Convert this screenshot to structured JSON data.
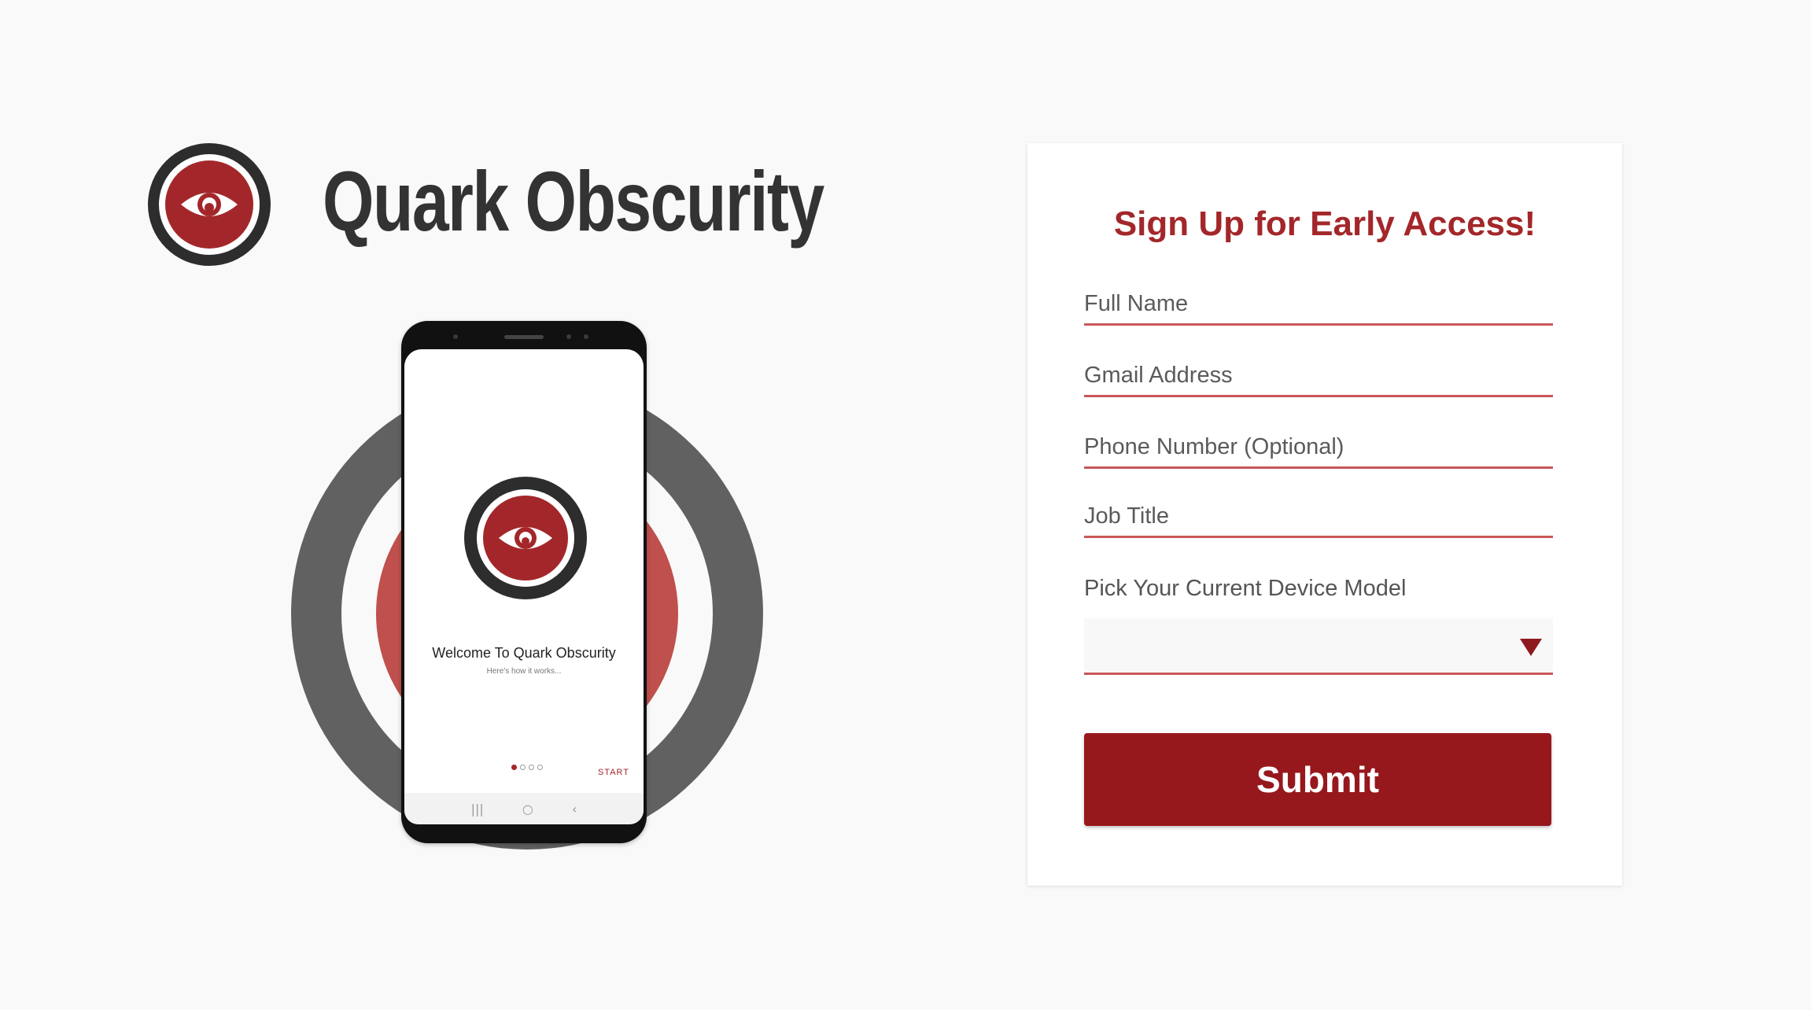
{
  "brand": {
    "name": "Quark Obscurity",
    "logo_icon": "eye-target-icon"
  },
  "phone_mockup": {
    "welcome_title": "Welcome To Quark Obscurity",
    "welcome_subtitle": "Here's how it works...",
    "start_label": "START",
    "page_count": 4,
    "active_page": 1,
    "nav_recent": "|||",
    "nav_home": "○",
    "nav_back": "‹"
  },
  "form": {
    "title": "Sign Up for Early Access!",
    "fields": [
      {
        "name": "full-name",
        "placeholder": "Full Name",
        "value": ""
      },
      {
        "name": "gmail-address",
        "placeholder": "Gmail Address",
        "value": ""
      },
      {
        "name": "phone-number",
        "placeholder": "Phone Number (Optional)",
        "value": ""
      },
      {
        "name": "job-title",
        "placeholder": "Job Title",
        "value": ""
      }
    ],
    "device_label": "Pick Your Current Device Model",
    "device_selected": "",
    "submit_label": "Submit"
  },
  "colors": {
    "accent": "#a3272a",
    "button": "#96181d",
    "ring_dark": "#616161",
    "ring_red": "#c0504d",
    "text_dark": "#333333",
    "background": "#f9f9f9"
  }
}
